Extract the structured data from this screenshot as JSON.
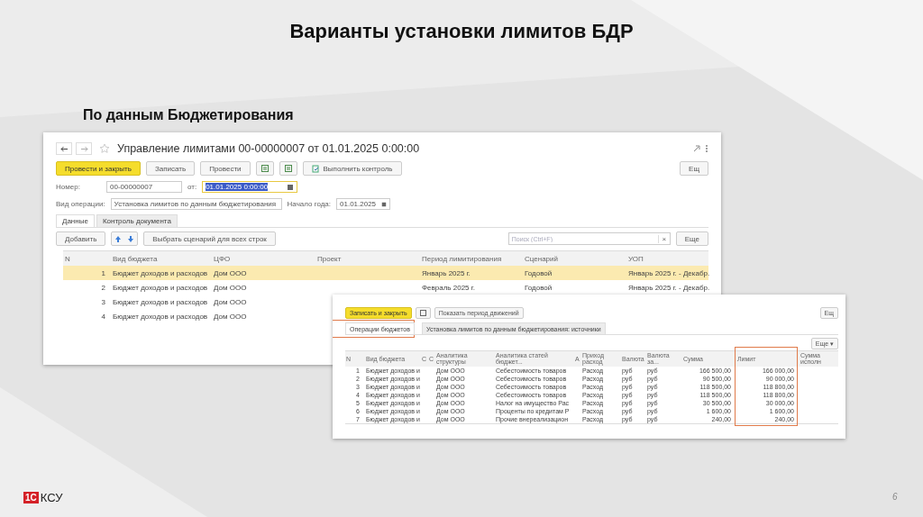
{
  "slide": {
    "title": "Варианты установки лимитов БДР",
    "subtitle": "По данным Бюджетирования",
    "logo_mark": "1С",
    "logo_text": "КСУ",
    "page_number": "6"
  },
  "main_window": {
    "title": "Управление лимитами 00-00000007 от 01.01.2025 0:00:00",
    "toolbar": [
      {
        "label": "Провести и закрыть",
        "kind": "primary"
      },
      {
        "label": "Записать",
        "kind": "plain"
      },
      {
        "label": "Провести",
        "kind": "plain"
      },
      {
        "kind": "icon"
      },
      {
        "kind": "icon"
      },
      {
        "label": "Выполнить контроль",
        "kind": "with-icon"
      }
    ],
    "more_button": "Ещ",
    "number_label": "Номер:",
    "number_value": "00-00000007",
    "date_label": "от:",
    "date_value": "01.01.2025  0:00:00",
    "operation_label": "Вид операции:",
    "operation_value": "Установка лимитов по данным бюджетирования",
    "year_label": "Начало года:",
    "year_value": "01.01.2025",
    "tabs": [
      {
        "label": "Данные",
        "selected": true
      },
      {
        "label": "Контроль документа",
        "selected": false
      }
    ],
    "add_button": "Добавить",
    "scenario_button": "Выбрать сценарий для всех строк",
    "search": {
      "placeholder": "Поиск (Ctrl+F)",
      "clear_glyph": "×"
    },
    "table_more_button": "Еще",
    "columns": [
      "N",
      "Вид бюджета",
      "ЦФО",
      "Проект",
      "Период лимитирования",
      "Сценарий",
      "УОП"
    ],
    "rows": [
      {
        "selected": true,
        "cells": [
          "1",
          "Бюджет доходов и расходов",
          "Дом ООО",
          "",
          "Январь 2025 г.",
          "Годовой",
          "Январь 2025 г. - Декабр."
        ]
      },
      {
        "selected": false,
        "cells": [
          "2",
          "Бюджет доходов и расходов",
          "Дом ООО",
          "",
          "Февраль 2025 г.",
          "Годовой",
          "Январь 2025 г. - Декабр."
        ]
      },
      {
        "selected": false,
        "cells": [
          "3",
          "Бюджет доходов и расходов",
          "Дом ООО"
        ]
      },
      {
        "selected": false,
        "cells": [
          "4",
          "Бюджет доходов и расходов",
          "Дом ООО"
        ]
      }
    ]
  },
  "detail_window": {
    "save_button": "Записать и закрыть",
    "movements_button": "Показать период движений",
    "more_button": "Ещ",
    "tabs": [
      {
        "label": "Операции бюджетов",
        "selected": true
      },
      {
        "label": "Установка лимитов по данным бюджетирования: источники",
        "selected": false
      }
    ],
    "table_more_button": "Еще ▾",
    "columns": [
      "N",
      "Вид бюджета",
      "С",
      "С",
      "Аналитика структуры",
      "Аналитика статей бюджет...",
      "А",
      "Приход расход",
      "Валюта",
      "Валюта за...",
      "Сумма",
      "Лимит",
      "Сумма исполн"
    ],
    "rows": [
      [
        "1",
        "Бюджет доходов и",
        "",
        "",
        "Дом ООО",
        "Себестоимость товаров",
        "",
        "Расход",
        "руб",
        "руб",
        "166 500,00",
        "166 000,00",
        ""
      ],
      [
        "2",
        "Бюджет доходов и",
        "",
        "",
        "Дом ООО",
        "Себестоимость товаров",
        "",
        "Расход",
        "руб",
        "руб",
        "90 500,00",
        "90 000,00",
        ""
      ],
      [
        "3",
        "Бюджет доходов и",
        "",
        "",
        "Дом ООО",
        "Себестоимость товаров",
        "",
        "Расход",
        "руб",
        "руб",
        "118 500,00",
        "118 800,00",
        ""
      ],
      [
        "4",
        "Бюджет доходов и",
        "",
        "",
        "Дом ООО",
        "Себестоимость товаров",
        "",
        "Расход",
        "руб",
        "руб",
        "118 500,00",
        "118 800,00",
        ""
      ],
      [
        "5",
        "Бюджет доходов и",
        "",
        "",
        "Дом ООО",
        "Налог на имущество Рас",
        "",
        "Расход",
        "руб",
        "руб",
        "30 500,00",
        "30 000,00",
        ""
      ],
      [
        "6",
        "Бюджет доходов и",
        "",
        "",
        "Дом ООО",
        "Проценты по кредитам Р",
        "",
        "Расход",
        "руб",
        "руб",
        "1 600,00",
        "1 600,00",
        ""
      ],
      [
        "7",
        "Бюджет доходов и",
        "",
        "",
        "Дом ООО",
        "Прочие внереализацион",
        "",
        "Расход",
        "руб",
        "руб",
        "240,00",
        "240,00",
        ""
      ]
    ]
  }
}
